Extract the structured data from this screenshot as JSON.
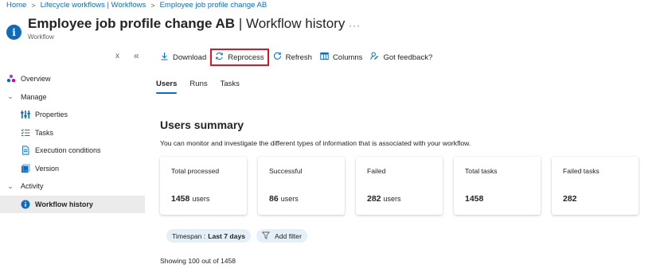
{
  "breadcrumb": {
    "items": [
      "Home",
      "Lifecycle workflows | Workflows",
      "Employee job profile change AB"
    ],
    "separator": ">"
  },
  "header": {
    "title_bold": "Employee job profile change AB",
    "title_rest": " | Workflow history",
    "subtitle": "Workflow",
    "more": "···",
    "icon": "info-icon"
  },
  "sidebar": {
    "collapse_x": "x",
    "collapse_chevron": "«",
    "items": [
      {
        "label": "Overview",
        "icon": "overview-icon"
      },
      {
        "label": "Manage",
        "icon": "chevron-down-icon"
      },
      {
        "label": "Properties",
        "icon": "properties-icon"
      },
      {
        "label": "Tasks",
        "icon": "tasks-icon"
      },
      {
        "label": "Execution conditions",
        "icon": "document-icon"
      },
      {
        "label": "Version",
        "icon": "version-icon"
      },
      {
        "label": "Activity",
        "icon": "chevron-down-icon"
      },
      {
        "label": "Workflow history",
        "icon": "info-icon"
      }
    ]
  },
  "toolbar": {
    "download": "Download",
    "reprocess": "Reprocess",
    "refresh": "Refresh",
    "columns": "Columns",
    "feedback": "Got feedback?"
  },
  "tabs": [
    "Users",
    "Runs",
    "Tasks"
  ],
  "summary": {
    "title": "Users summary",
    "description": "You can monitor and investigate the different types of information that is associated with your workflow."
  },
  "cards": [
    {
      "label": "Total processed",
      "value": "1458",
      "unit": "users"
    },
    {
      "label": "Successful",
      "value": "86",
      "unit": "users"
    },
    {
      "label": "Failed",
      "value": "282",
      "unit": "users"
    },
    {
      "label": "Total tasks",
      "value": "1458",
      "unit": ""
    },
    {
      "label": "Failed tasks",
      "value": "282",
      "unit": ""
    }
  ],
  "filters": {
    "timespan_label": "Timespan :",
    "timespan_value": "Last 7 days",
    "add_filter": "Add filter"
  },
  "showing": "Showing 100 out of 1458",
  "colors": {
    "accent": "#0f6cbd",
    "highlight_border": "#e81123",
    "selected_nav": "#ebebeb",
    "pill_bg": "#e5eff8"
  }
}
